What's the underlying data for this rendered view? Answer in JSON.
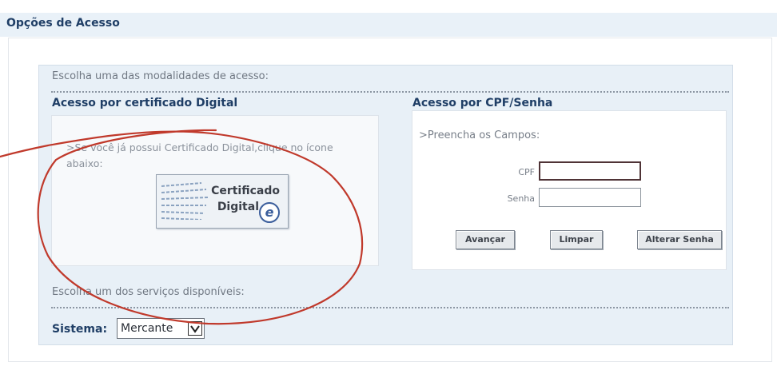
{
  "header": {
    "title": "Opções de Acesso"
  },
  "panel": {
    "choose_access": "Escolha uma das modalidades de acesso:",
    "choose_service": "Escolha um dos serviços disponíveis:"
  },
  "certificate": {
    "title": "Acesso por certificado Digital",
    "instruction": ">Se você já possui Certificado Digital,clique no ícone abaixo:",
    "button_line1": "Certificado",
    "button_line2": "Digital",
    "button_icon": "e"
  },
  "cpf_login": {
    "title": "Acesso por CPF/Senha",
    "fill_fields": ">Preencha os Campos:",
    "cpf_label": "CPF",
    "cpf_value": "",
    "senha_label": "Senha",
    "senha_value": "",
    "buttons": {
      "advance": "Avançar",
      "clear": "Limpar",
      "change_password": "Alterar Senha"
    }
  },
  "system": {
    "label": "Sistema:",
    "selected": "Mercante"
  },
  "colors": {
    "accent": "#1f3e66",
    "panel_bg": "#e8f0f7",
    "annotation": "#c0392b"
  }
}
